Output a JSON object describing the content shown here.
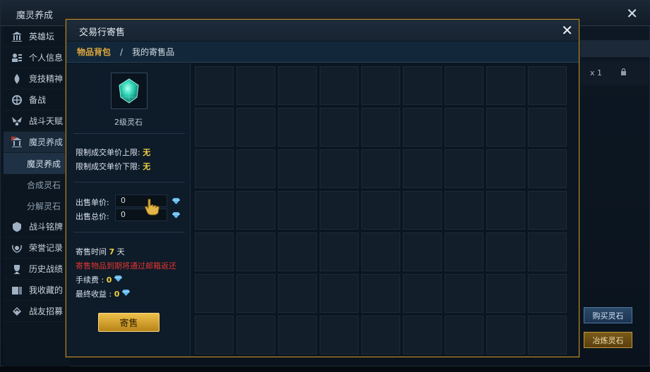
{
  "background_window": {
    "title": "魔灵养成",
    "close_glyph": "✕",
    "sidebar": [
      {
        "label": "英雄坛",
        "icon": "temple-icon"
      },
      {
        "label": "个人信息",
        "icon": "profile-icon"
      },
      {
        "label": "竞技精神",
        "icon": "flame-icon"
      },
      {
        "label": "备战",
        "icon": "globe-icon"
      },
      {
        "label": "战斗天赋",
        "icon": "wings-icon"
      },
      {
        "label": "魔灵养成",
        "icon": "shrine-icon"
      }
    ],
    "sidebar_sub": [
      "魔灵养成",
      "合成灵石",
      "分解灵石"
    ],
    "sidebar_more": [
      {
        "label": "战斗铭牌",
        "icon": "badge-icon"
      },
      {
        "label": "荣誉记录",
        "icon": "laurel-icon"
      },
      {
        "label": "历史战绩",
        "icon": "trophy-icon"
      },
      {
        "label": "我收藏的",
        "icon": "collection-icon"
      },
      {
        "label": "战友招募",
        "icon": "recruit-icon"
      }
    ],
    "right_slot": {
      "count": "x 1",
      "lock_icon": "lock-icon"
    },
    "buy_button": "购买灵石",
    "refine_button": "冶炼灵石"
  },
  "modal": {
    "title": "交易行寄售",
    "close_glyph": "✕",
    "tab_bag": "物品背包",
    "tab_separator": "/",
    "tab_mine": "我的寄售品",
    "item_name": "2级灵石",
    "max_price_label": "限制成交单价上限:",
    "max_price_value": "无",
    "min_price_label": "限制成交单价下限:",
    "min_price_value": "无",
    "unit_price_label": "出售单价:",
    "unit_price_value": "0",
    "total_price_label": "出售总价:",
    "total_price_value": "0",
    "duration_label": "寄售时间",
    "duration_value": "7",
    "duration_unit": "天",
    "warning": "寄售物品到期将通过邮箱返还",
    "fee_label": "手续费 :",
    "fee_value": "0",
    "earnings_label": "最终收益 :",
    "earnings_value": "0",
    "sell_button": "寄售"
  },
  "colors": {
    "gold_border": "#b18a34",
    "yellow_value": "#f0d040",
    "warning_red": "#e2352e",
    "tab_orange": "#e0a73c"
  }
}
